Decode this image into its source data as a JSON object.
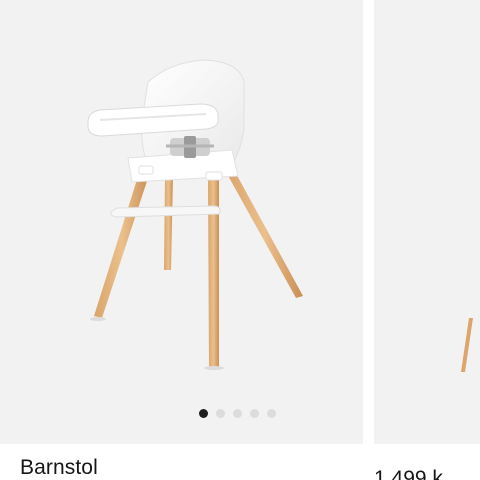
{
  "products": [
    {
      "name": "Barnstol",
      "image_icon": "high-chair-image",
      "carousel": {
        "total": 5,
        "active_index": 0
      }
    },
    {
      "price": "1 499 k",
      "image_icon": "high-chair-image-partial"
    }
  ],
  "colors": {
    "image_background": "#f2f2f2",
    "dot_active": "#1e1e1e",
    "dot_inactive": "#dcdcdc",
    "text": "#161616"
  }
}
